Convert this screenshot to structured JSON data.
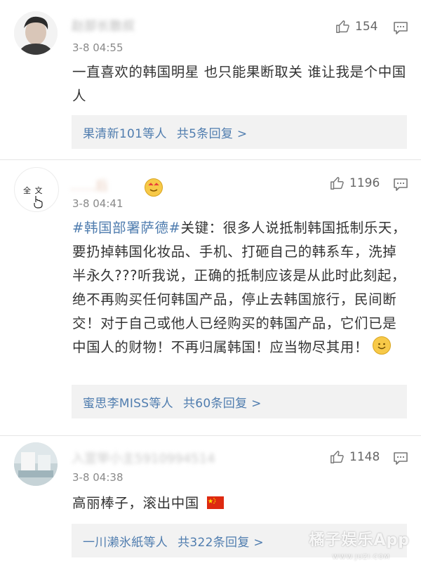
{
  "comments": [
    {
      "username": "赵部长散叔",
      "time": "3-8 04:55",
      "likes": "154",
      "text": "一直喜欢的韩国明星 也只能果断取关 谁让我是个中国人",
      "reply_users": "果清新101等人",
      "reply_count": "共5条回复 >"
    },
    {
      "username": "……后",
      "avatar_text": "全 文",
      "time": "3-8 04:41",
      "likes": "1196",
      "hashtag": "#韩国部署萨德#",
      "text": "关键：很多人说抵制韩国抵制乐天，要扔掉韩国化妆品、手机、打砸自己的韩系车，洗掉半永久???听我说，正确的抵制应该是从此时此刻起，绝不再购买任何韩国产品，停止去韩国旅行，民间断交！对于自己或他人已经购买的韩国产品，它们已是中国人的财物！不再归属韩国！应当物尽其用！",
      "reply_users": "蜜思李MISS等人",
      "reply_count": "共60条回复 >"
    },
    {
      "username": "入宣举小主5910994514",
      "time": "3-8 04:38",
      "likes": "1148",
      "text": "高丽棒子，滚出中国",
      "reply_users": "一川濑氷紙等人",
      "reply_count": "共322条回复 >"
    }
  ],
  "watermark": {
    "title": "橘子娱乐App",
    "sub": "WWW.JUZI.COM"
  },
  "colors": {
    "link": "#507daf",
    "reply_bg": "#f2f2f2",
    "flag": "#de2910"
  }
}
